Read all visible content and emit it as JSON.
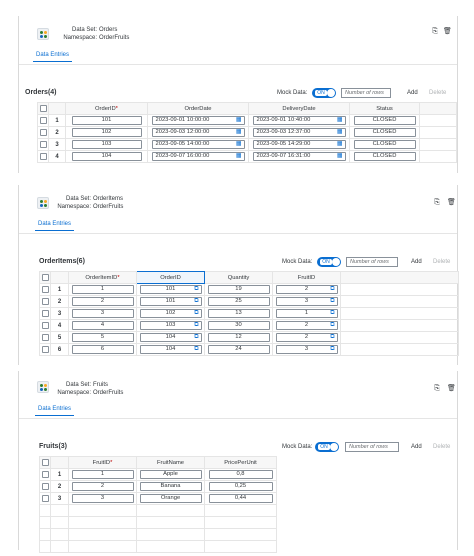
{
  "panels": [
    {
      "dataset_label": "Data Set:",
      "dataset": "Orders",
      "namespace_label": "Namespace:",
      "namespace": "OrderFruits",
      "tab": "Data Entries",
      "table_title": "Orders(4)",
      "columns": [
        "OrderID",
        "OrderDate",
        "DeliveryDate",
        "Status"
      ],
      "rows": [
        {
          "idx": "1",
          "c": [
            "101",
            "2023-09-01 10:00:00",
            "2023-09-01 10:40:00",
            "CLOSED"
          ]
        },
        {
          "idx": "2",
          "c": [
            "102",
            "2023-09-03 12:00:00",
            "2023-09-03 12:37:00",
            "CLOSED"
          ]
        },
        {
          "idx": "3",
          "c": [
            "103",
            "2023-09-05 14:00:00",
            "2023-09-05 14:29:00",
            "CLOSED"
          ]
        },
        {
          "idx": "4",
          "c": [
            "104",
            "2023-09-07 16:00:00",
            "2023-09-07 16:31:00",
            "CLOSED"
          ]
        }
      ]
    },
    {
      "dataset_label": "Data Set:",
      "dataset": "OrderItems",
      "namespace_label": "Namespace:",
      "namespace": "OrderFruits",
      "tab": "Data Entries",
      "table_title": "OrderItems(6)",
      "columns": [
        "OrderItemID",
        "OrderID",
        "Quantity",
        "FruitID"
      ],
      "rows": [
        {
          "idx": "1",
          "c": [
            "1",
            "101",
            "19",
            "2"
          ]
        },
        {
          "idx": "2",
          "c": [
            "2",
            "101",
            "25",
            "3"
          ]
        },
        {
          "idx": "3",
          "c": [
            "3",
            "102",
            "13",
            "1"
          ]
        },
        {
          "idx": "4",
          "c": [
            "4",
            "103",
            "30",
            "2"
          ]
        },
        {
          "idx": "5",
          "c": [
            "5",
            "104",
            "12",
            "2"
          ]
        },
        {
          "idx": "6",
          "c": [
            "6",
            "104",
            "24",
            "3"
          ]
        }
      ]
    },
    {
      "dataset_label": "Data Set:",
      "dataset": "Fruits",
      "namespace_label": "Namespace:",
      "namespace": "OrderFruits",
      "tab": "Data Entries",
      "table_title": "Fruits(3)",
      "columns": [
        "FruitID",
        "FruitName",
        "PricePerUnit"
      ],
      "rows": [
        {
          "idx": "1",
          "c": [
            "1",
            "Apple",
            "0,8"
          ]
        },
        {
          "idx": "2",
          "c": [
            "2",
            "Banana",
            "0,25"
          ]
        },
        {
          "idx": "3",
          "c": [
            "3",
            "Orange",
            "0,44"
          ]
        }
      ]
    }
  ],
  "toolbar": {
    "mock_label": "Mock Data:",
    "toggle_on": "ON",
    "rows_placeholder": "Number of rows",
    "add": "Add",
    "delete": "Delete"
  },
  "icons": {
    "dataset": "dataset-icon",
    "export": "export-icon",
    "delete": "trash-icon",
    "calendar": "calendar-icon",
    "value_help": "value-help-icon"
  },
  "colors": {
    "accent": "#0a6ed1",
    "required": "#bb0000"
  }
}
